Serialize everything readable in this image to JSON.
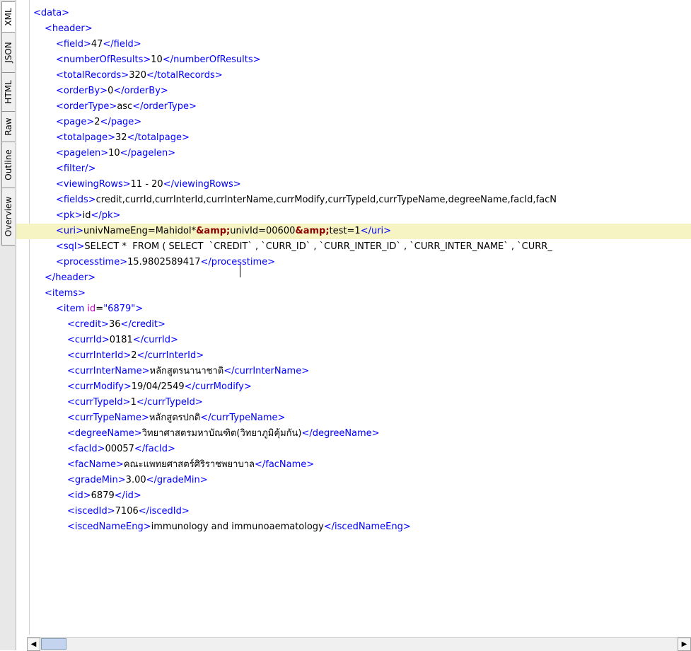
{
  "tabs": [
    {
      "label": "XML",
      "active": true
    },
    {
      "label": "JSON",
      "active": false
    },
    {
      "label": "HTML",
      "active": false
    },
    {
      "label": "Raw",
      "active": false
    },
    {
      "label": "Outline",
      "active": false
    },
    {
      "label": "Overview",
      "active": false
    }
  ],
  "lines": [
    {
      "indent": 0,
      "segments": [
        {
          "t": "t",
          "v": "<data>"
        }
      ]
    },
    {
      "indent": 1,
      "segments": [
        {
          "t": "t",
          "v": "<header>"
        }
      ]
    },
    {
      "indent": 2,
      "segments": [
        {
          "t": "t",
          "v": "<field>"
        },
        {
          "t": "x",
          "v": "47"
        },
        {
          "t": "t",
          "v": "</field>"
        }
      ]
    },
    {
      "indent": 2,
      "segments": [
        {
          "t": "t",
          "v": "<numberOfResults>"
        },
        {
          "t": "x",
          "v": "10"
        },
        {
          "t": "t",
          "v": "</numberOfResults>"
        }
      ]
    },
    {
      "indent": 2,
      "segments": [
        {
          "t": "t",
          "v": "<totalRecords>"
        },
        {
          "t": "x",
          "v": "320"
        },
        {
          "t": "t",
          "v": "</totalRecords>"
        }
      ]
    },
    {
      "indent": 2,
      "segments": [
        {
          "t": "t",
          "v": "<orderBy>"
        },
        {
          "t": "x",
          "v": "0"
        },
        {
          "t": "t",
          "v": "</orderBy>"
        }
      ]
    },
    {
      "indent": 2,
      "segments": [
        {
          "t": "t",
          "v": "<orderType>"
        },
        {
          "t": "x",
          "v": "asc"
        },
        {
          "t": "t",
          "v": "</orderType>"
        }
      ]
    },
    {
      "indent": 2,
      "segments": [
        {
          "t": "t",
          "v": "<page>"
        },
        {
          "t": "x",
          "v": "2"
        },
        {
          "t": "t",
          "v": "</page>"
        }
      ]
    },
    {
      "indent": 2,
      "segments": [
        {
          "t": "t",
          "v": "<totalpage>"
        },
        {
          "t": "x",
          "v": "32"
        },
        {
          "t": "t",
          "v": "</totalpage>"
        }
      ]
    },
    {
      "indent": 2,
      "segments": [
        {
          "t": "t",
          "v": "<pagelen>"
        },
        {
          "t": "x",
          "v": "10"
        },
        {
          "t": "t",
          "v": "</pagelen>"
        }
      ]
    },
    {
      "indent": 2,
      "segments": [
        {
          "t": "t",
          "v": "<filter/>"
        }
      ]
    },
    {
      "indent": 2,
      "segments": [
        {
          "t": "t",
          "v": "<viewingRows>"
        },
        {
          "t": "x",
          "v": "11 - 20"
        },
        {
          "t": "t",
          "v": "</viewingRows>"
        }
      ]
    },
    {
      "indent": 2,
      "segments": [
        {
          "t": "t",
          "v": "<fields>"
        },
        {
          "t": "x",
          "v": "credit,currId,currInterId,currInterName,currModify,currTypeId,currTypeName,degreeName,facId,facN"
        }
      ]
    },
    {
      "indent": 2,
      "segments": [
        {
          "t": "t",
          "v": "<pk>"
        },
        {
          "t": "x",
          "v": "id"
        },
        {
          "t": "t",
          "v": "</pk>"
        }
      ]
    },
    {
      "indent": 2,
      "highlight": true,
      "segments": [
        {
          "t": "t",
          "v": "<uri>"
        },
        {
          "t": "x",
          "v": "univNameEng=Mahidol*"
        },
        {
          "t": "e",
          "v": "&amp;"
        },
        {
          "t": "x",
          "v": "univId=00600"
        },
        {
          "t": "e",
          "v": "&amp;"
        },
        {
          "t": "x",
          "v": "test=1"
        },
        {
          "t": "t",
          "v": "</uri>"
        }
      ]
    },
    {
      "indent": 2,
      "segments": [
        {
          "t": "t",
          "v": "<sql>"
        },
        {
          "t": "x",
          "v": "SELECT *  FROM ( SELECT  `CREDIT` , `CURR_ID` , `CURR_INTER_ID` , `CURR_INTER_NAME` , `CURR_"
        }
      ]
    },
    {
      "indent": 2,
      "segments": [
        {
          "t": "t",
          "v": "<processtime>"
        },
        {
          "t": "x",
          "v": "15.9802589417"
        },
        {
          "t": "t",
          "v": "</processtime>"
        }
      ]
    },
    {
      "indent": 1,
      "segments": [
        {
          "t": "t",
          "v": "</header>"
        }
      ]
    },
    {
      "indent": 1,
      "segments": [
        {
          "t": "t",
          "v": "<items>"
        }
      ]
    },
    {
      "indent": 2,
      "segments": [
        {
          "t": "t",
          "v": "<item "
        },
        {
          "t": "a",
          "v": "id"
        },
        {
          "t": "x",
          "v": "="
        },
        {
          "t": "v",
          "v": "\"6879\""
        },
        {
          "t": "t",
          "v": ">"
        }
      ]
    },
    {
      "indent": 3,
      "segments": [
        {
          "t": "t",
          "v": "<credit>"
        },
        {
          "t": "x",
          "v": "36"
        },
        {
          "t": "t",
          "v": "</credit>"
        }
      ]
    },
    {
      "indent": 3,
      "segments": [
        {
          "t": "t",
          "v": "<currId>"
        },
        {
          "t": "x",
          "v": "0181"
        },
        {
          "t": "t",
          "v": "</currId>"
        }
      ]
    },
    {
      "indent": 3,
      "segments": [
        {
          "t": "t",
          "v": "<currInterId>"
        },
        {
          "t": "x",
          "v": "2"
        },
        {
          "t": "t",
          "v": "</currInterId>"
        }
      ]
    },
    {
      "indent": 3,
      "segments": [
        {
          "t": "t",
          "v": "<currInterName>"
        },
        {
          "t": "x",
          "v": "หลักสูตรนานาชาติ"
        },
        {
          "t": "t",
          "v": "</currInterName>"
        }
      ]
    },
    {
      "indent": 3,
      "segments": [
        {
          "t": "t",
          "v": "<currModify>"
        },
        {
          "t": "x",
          "v": "19/04/2549"
        },
        {
          "t": "t",
          "v": "</currModify>"
        }
      ]
    },
    {
      "indent": 3,
      "segments": [
        {
          "t": "t",
          "v": "<currTypeId>"
        },
        {
          "t": "x",
          "v": "1"
        },
        {
          "t": "t",
          "v": "</currTypeId>"
        }
      ]
    },
    {
      "indent": 3,
      "segments": [
        {
          "t": "t",
          "v": "<currTypeName>"
        },
        {
          "t": "x",
          "v": "หลักสูตรปกติ"
        },
        {
          "t": "t",
          "v": "</currTypeName>"
        }
      ]
    },
    {
      "indent": 3,
      "segments": [
        {
          "t": "t",
          "v": "<degreeName>"
        },
        {
          "t": "x",
          "v": "วิทยาศาสตรมหาบัณฑิต(วิทยาภูมิคุ้มกัน)"
        },
        {
          "t": "t",
          "v": "</degreeName>"
        }
      ]
    },
    {
      "indent": 3,
      "segments": [
        {
          "t": "t",
          "v": "<facId>"
        },
        {
          "t": "x",
          "v": "00057"
        },
        {
          "t": "t",
          "v": "</facId>"
        }
      ]
    },
    {
      "indent": 3,
      "segments": [
        {
          "t": "t",
          "v": "<facName>"
        },
        {
          "t": "x",
          "v": "คณะแพทยศาสตร์ศิริราชพยาบาล"
        },
        {
          "t": "t",
          "v": "</facName>"
        }
      ]
    },
    {
      "indent": 3,
      "segments": [
        {
          "t": "t",
          "v": "<gradeMin>"
        },
        {
          "t": "x",
          "v": "3.00"
        },
        {
          "t": "t",
          "v": "</gradeMin>"
        }
      ]
    },
    {
      "indent": 3,
      "segments": [
        {
          "t": "t",
          "v": "<id>"
        },
        {
          "t": "x",
          "v": "6879"
        },
        {
          "t": "t",
          "v": "</id>"
        }
      ]
    },
    {
      "indent": 3,
      "segments": [
        {
          "t": "t",
          "v": "<iscedId>"
        },
        {
          "t": "x",
          "v": "7106"
        },
        {
          "t": "t",
          "v": "</iscedId>"
        }
      ]
    },
    {
      "indent": 3,
      "segments": [
        {
          "t": "t",
          "v": "<iscedNameEng>"
        },
        {
          "t": "x",
          "v": "immunology and immunoaematology"
        },
        {
          "t": "t",
          "v": "</iscedNameEng>"
        }
      ]
    }
  ],
  "scrollbar": {
    "left_arrow": "◀",
    "right_arrow": "▶",
    "left_arrow_icon": "left-arrow-icon",
    "right_arrow_icon": "right-arrow-icon"
  },
  "colors": {
    "tag": "#0000ff",
    "attr_name": "#c000c0",
    "attr_value": "#0000ff",
    "entity": "#8b0000",
    "text": "#000000",
    "highlight_line": "#f7f4c4"
  }
}
